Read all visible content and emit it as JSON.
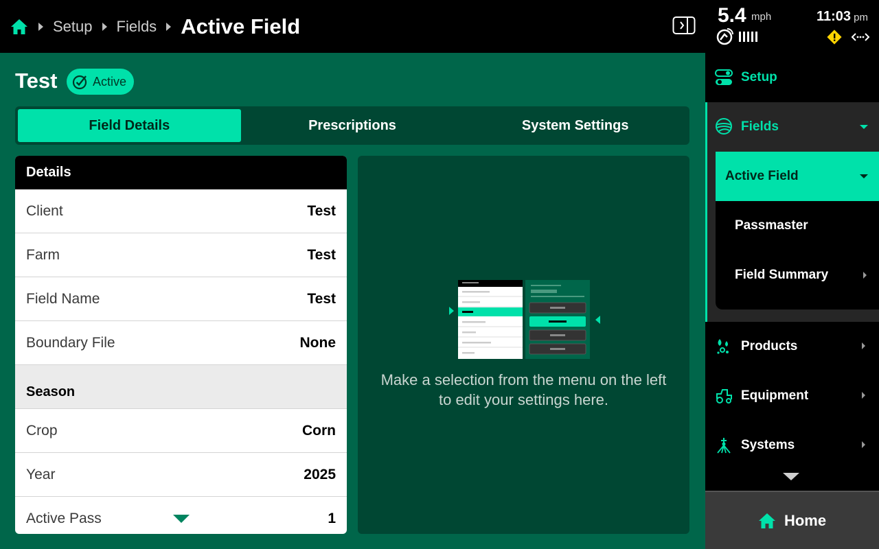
{
  "breadcrumb": {
    "items": [
      "Setup",
      "Fields"
    ],
    "current": "Active Field"
  },
  "status": {
    "speed": "5.4",
    "speed_unit": "mph",
    "time": "11:03",
    "time_unit": "pm"
  },
  "field": {
    "name": "Test",
    "badge": "Active"
  },
  "tabs": [
    {
      "label": "Field Details",
      "selected": true
    },
    {
      "label": "Prescriptions",
      "selected": false
    },
    {
      "label": "System Settings",
      "selected": false
    }
  ],
  "details": {
    "header": "Details",
    "rows": [
      {
        "label": "Client",
        "value": "Test"
      },
      {
        "label": "Farm",
        "value": "Test"
      },
      {
        "label": "Field Name",
        "value": "Test"
      },
      {
        "label": "Boundary File",
        "value": "None"
      }
    ],
    "season_header": "Season",
    "season_rows": [
      {
        "label": "Crop",
        "value": "Corn"
      },
      {
        "label": "Year",
        "value": "2025"
      },
      {
        "label": "Active Pass",
        "value": "1"
      }
    ]
  },
  "info_text": "Make a selection from the menu on the left to edit your settings here.",
  "sidebar": {
    "setup": "Setup",
    "fields": "Fields",
    "active_field": "Active Field",
    "passmaster": "Passmaster",
    "field_summary": "Field Summary",
    "products": "Products",
    "equipment": "Equipment",
    "systems": "Systems",
    "home": "Home"
  },
  "colors": {
    "accent": "#00e1aa",
    "main_bg": "#00664a",
    "panel_bg": "#004733",
    "warning": "#ffd400"
  },
  "icons": {
    "home": "home-icon",
    "panel_toggle": "panel-toggle-icon",
    "gps": "gps-signal-icon",
    "warning": "warning-icon",
    "link": "connection-icon",
    "setup": "toggle-icon",
    "fields": "field-icon",
    "products": "products-icon",
    "equipment": "tractor-icon",
    "systems": "sprayer-icon"
  }
}
